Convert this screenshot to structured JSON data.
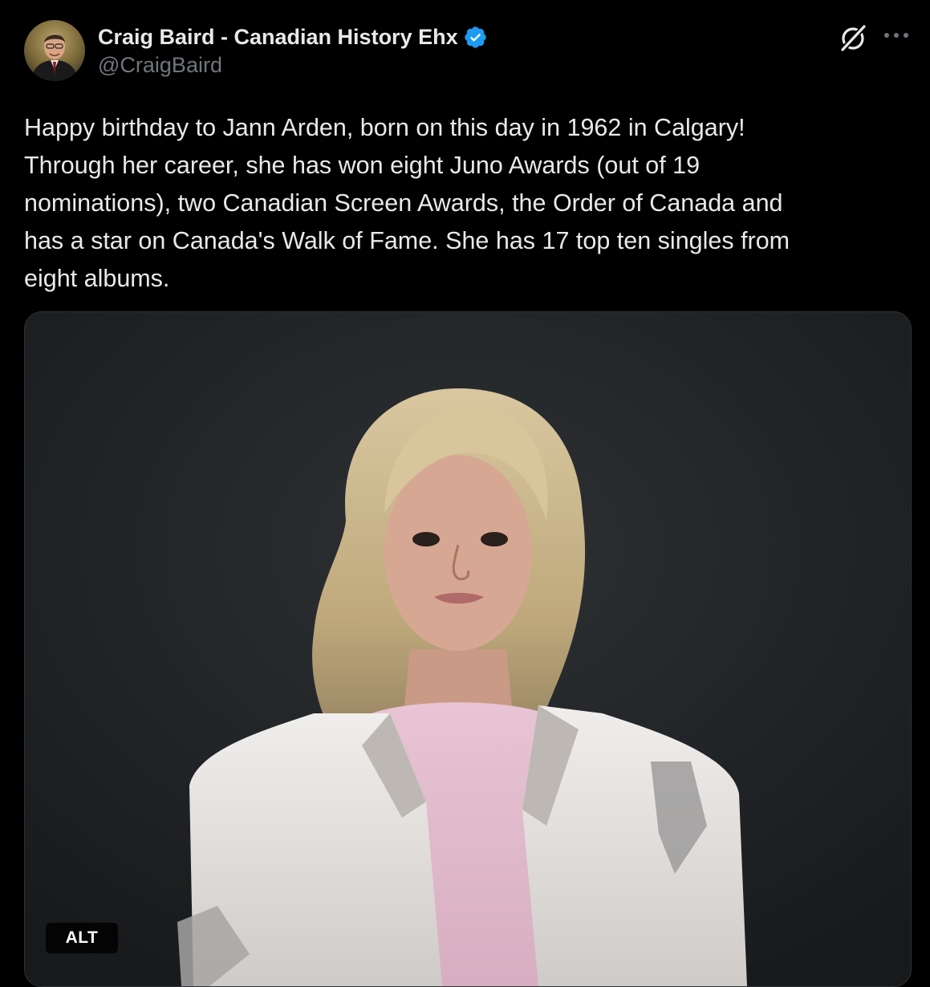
{
  "author": {
    "name": "Craig Baird - Canadian History Ehx",
    "handle": "@CraigBaird",
    "verified": true
  },
  "icons": {
    "avatar": "avatar",
    "verified": "verified-badge-icon",
    "grok": "grok-icon",
    "more": "more-options-icon"
  },
  "post": {
    "text": "Happy birthday to Jann Arden, born on this day in 1962 in Calgary!\nThrough her career, she has won eight Juno Awards (out of 19\nnominations), two Canadian Screen Awards, the Order of Canada and\nhas a star on Canada's Walk of Fame. She has 17 top ten singles from\neight albums."
  },
  "media": {
    "alt_label": "ALT"
  },
  "colors": {
    "background": "#000000",
    "text_primary": "#e7e9ea",
    "text_secondary": "#71767b",
    "verified_blue": "#1d9bf0",
    "media_border": "#2f3336"
  }
}
